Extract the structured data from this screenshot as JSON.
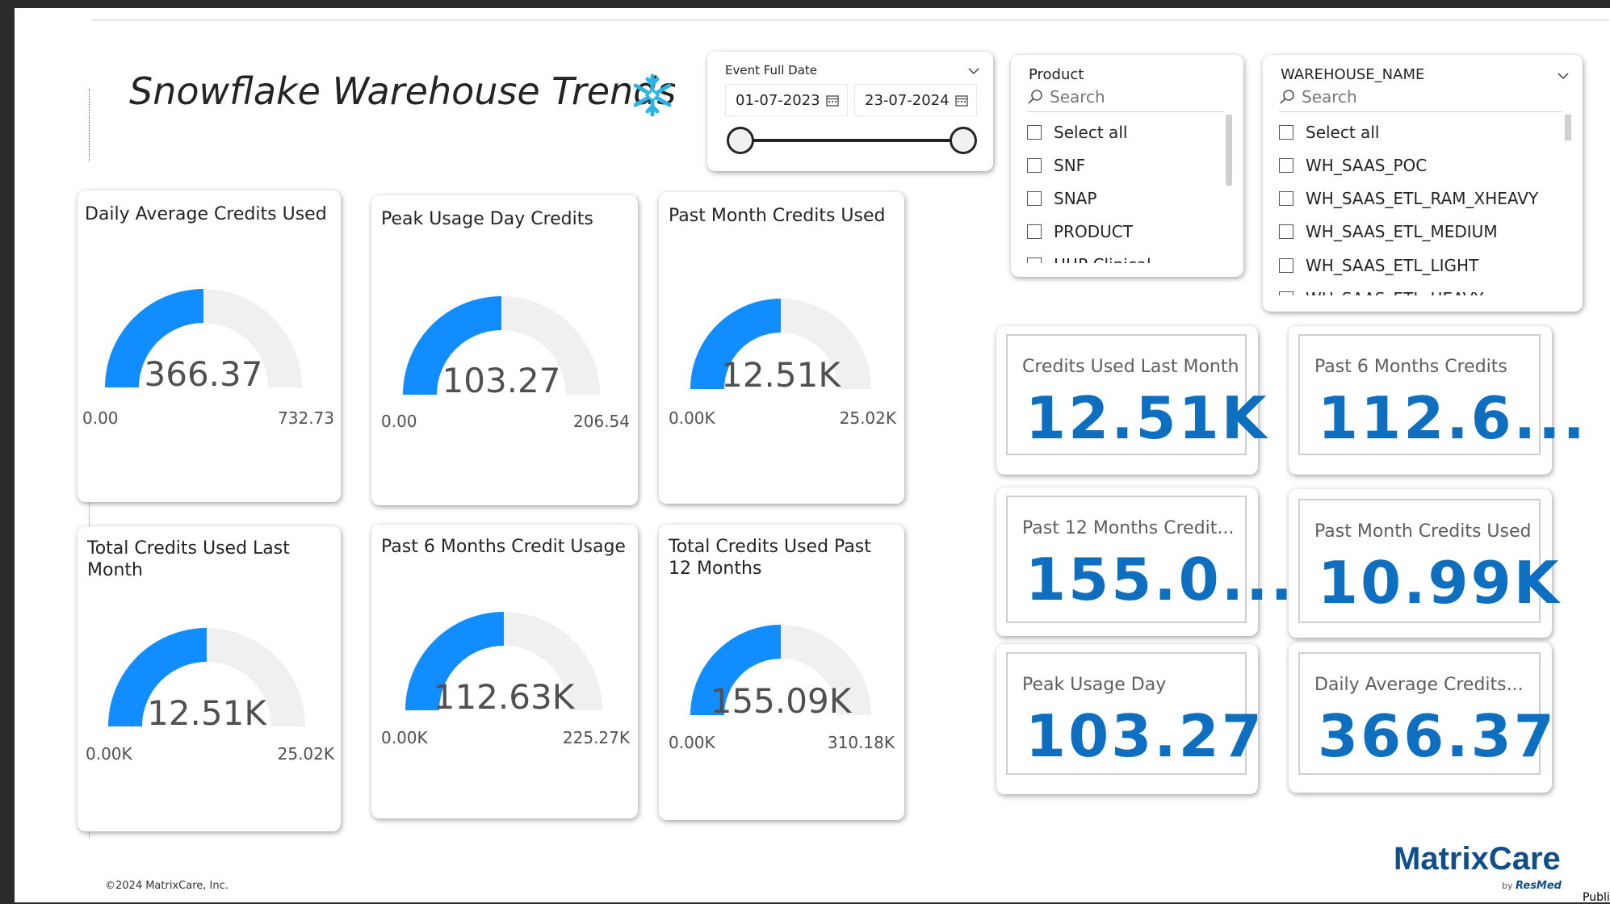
{
  "page": {
    "title": "Snowflake Warehouse Trends"
  },
  "date_slicer": {
    "title": "Event Full Date",
    "start_date": "01-07-2023",
    "end_date": "23-07-2024"
  },
  "product_slicer": {
    "title": "Product",
    "search_placeholder": "Search",
    "options": [
      "Select all",
      "SNF",
      "SNAP",
      "PRODUCT",
      "HHP Clinical"
    ]
  },
  "warehouse_slicer": {
    "title": "WAREHOUSE_NAME",
    "search_placeholder": "Search",
    "options": [
      "Select all",
      "WH_SAAS_POC",
      "WH_SAAS_ETL_RAM_XHEAVY",
      "WH_SAAS_ETL_MEDIUM",
      "WH_SAAS_ETL_LIGHT",
      "WH_SAAS_ETL_HEAVY"
    ]
  },
  "gauges": [
    {
      "title": "Daily Average Credits Used",
      "value_label": "366.37",
      "min_label": "0.00",
      "max_label": "732.73",
      "fraction": 0.5
    },
    {
      "title": "Peak Usage Day Credits",
      "value_label": "103.27",
      "min_label": "0.00",
      "max_label": "206.54",
      "fraction": 0.5
    },
    {
      "title": "Past Month Credits Used",
      "value_label": "12.51K",
      "min_label": "0.00K",
      "max_label": "25.02K",
      "fraction": 0.5
    },
    {
      "title": "Total Credits Used Last Month",
      "value_label": "12.51K",
      "min_label": "0.00K",
      "max_label": "25.02K",
      "fraction": 0.5
    },
    {
      "title": "Past 6 Months Credit Usage",
      "value_label": "112.63K",
      "min_label": "0.00K",
      "max_label": "225.27K",
      "fraction": 0.5
    },
    {
      "title": "Total Credits Used Past 12 Months",
      "value_label": "155.09K",
      "min_label": "0.00K",
      "max_label": "310.18K",
      "fraction": 0.5
    }
  ],
  "kpis": [
    {
      "label": "Credits Used Last Month",
      "value": "12.51K"
    },
    {
      "label": "Past 6 Months Credits",
      "value": "112.6..."
    },
    {
      "label": "Past 12 Months Credit...",
      "value": "155.0..."
    },
    {
      "label": "Past Month Credits Used",
      "value": "10.99K"
    },
    {
      "label": "Peak Usage Day",
      "value": "103.27"
    },
    {
      "label": "Daily Average Credits...",
      "value": "366.37"
    }
  ],
  "footer": {
    "copyright": "©2024 MatrixCare, Inc.",
    "logo_text": "MatrixCare",
    "logo_by": "by",
    "logo_sub": "ResMed",
    "classification": "Public"
  },
  "colors": {
    "accent": "#118DFF",
    "track": "#F0F0F0",
    "kpi_value": "#0E6FC0"
  }
}
